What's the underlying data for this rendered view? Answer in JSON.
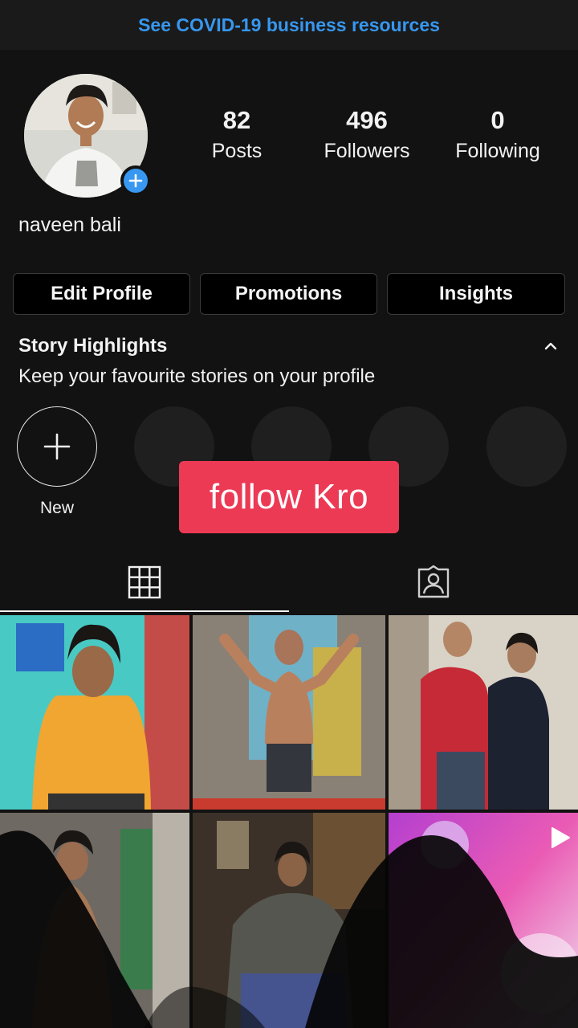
{
  "banner": {
    "text": "See COVID-19 business resources"
  },
  "profile": {
    "username": "naveen bali",
    "stats": [
      {
        "num": "82",
        "label": "Posts"
      },
      {
        "num": "496",
        "label": "Followers"
      },
      {
        "num": "0",
        "label": "Following"
      }
    ]
  },
  "actions": {
    "edit": "Edit Profile",
    "promotions": "Promotions",
    "insights": "Insights"
  },
  "highlights": {
    "title": "Story Highlights",
    "subtitle": "Keep your favourite stories on your profile",
    "new_label": "New"
  },
  "overlay": {
    "text": "follow Kro"
  },
  "icons": {
    "add": "plus-icon",
    "chevron": "chevron-up-icon",
    "grid": "grid-icon",
    "tagged": "tagged-person-icon",
    "video": "play-icon"
  },
  "colors": {
    "accent": "#3797ef",
    "tag": "#ec3a55",
    "bg": "#121212"
  }
}
